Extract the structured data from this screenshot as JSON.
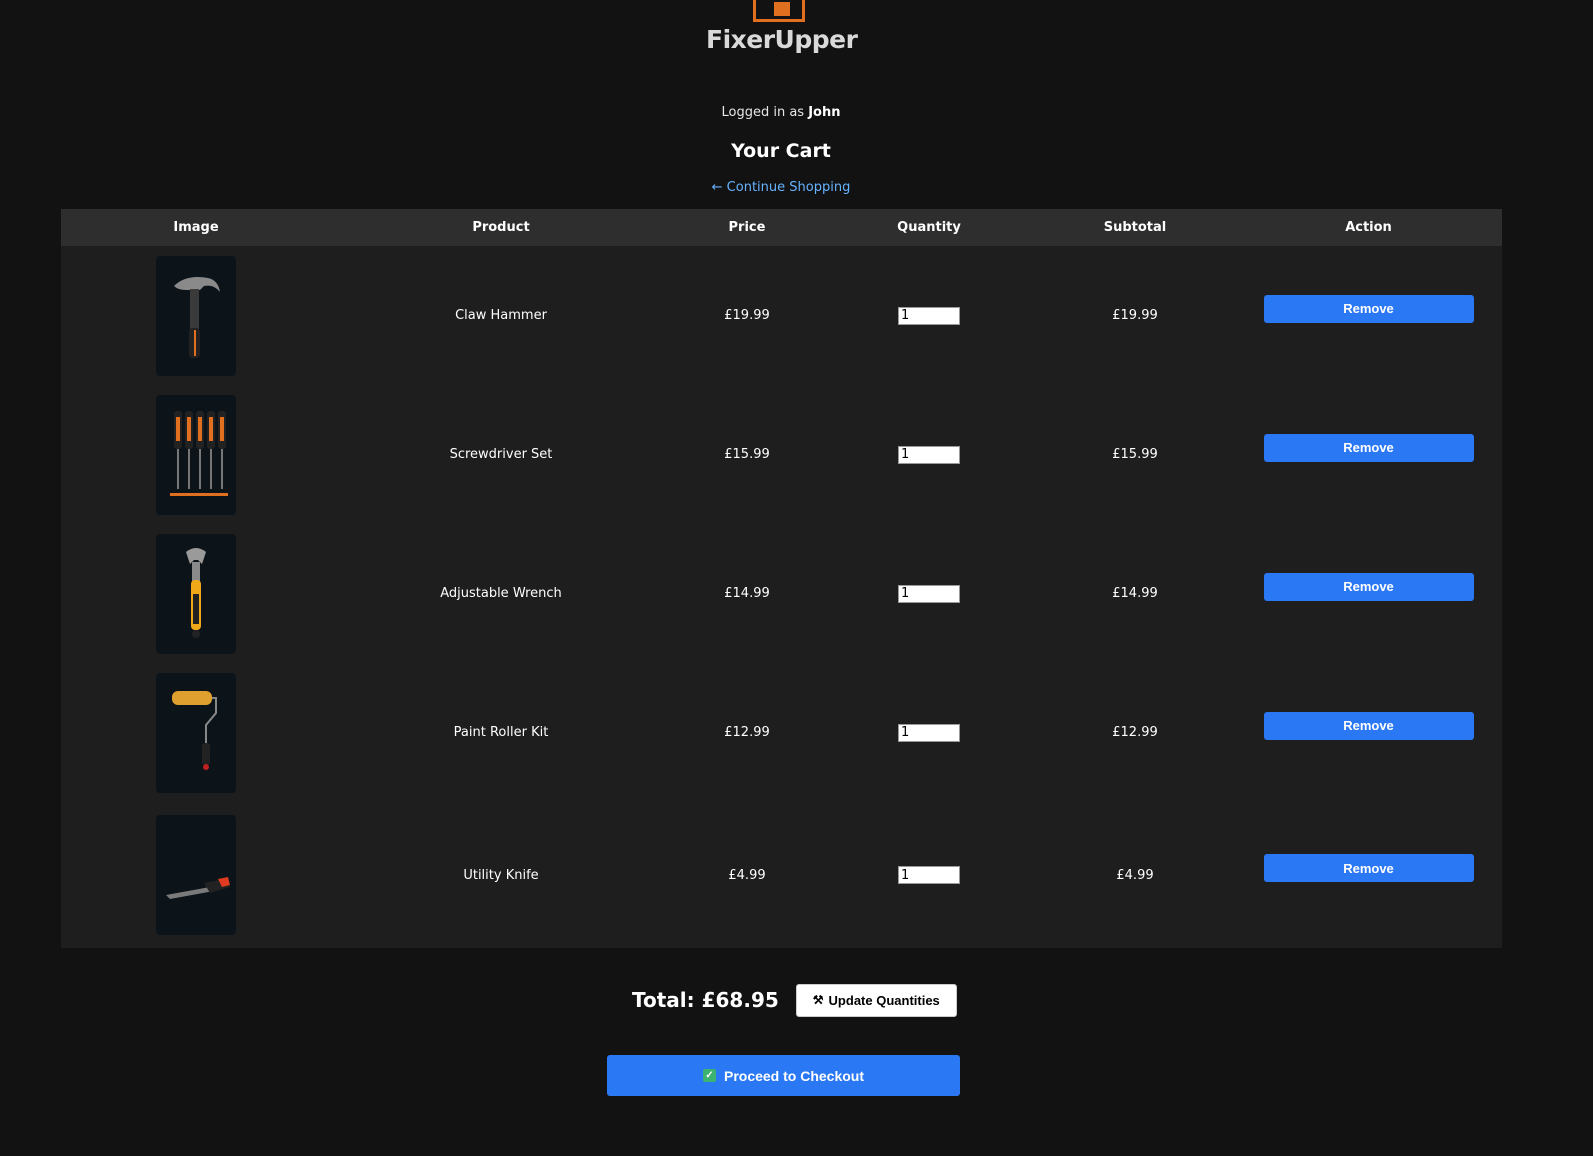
{
  "brand": {
    "name": "FixerUpper",
    "accent_color": "#e07020"
  },
  "session": {
    "prefix": "Logged in as",
    "username": "John"
  },
  "page": {
    "title": "Your Cart",
    "continue_link": "← Continue Shopping"
  },
  "cart": {
    "columns": [
      "Image",
      "Product",
      "Price",
      "Quantity",
      "Subtotal",
      "Action"
    ],
    "items": [
      {
        "product": "Claw Hammer",
        "price": "£19.99",
        "quantity": "1",
        "subtotal": "£19.99",
        "action": "Remove",
        "image_icon": "hammer-icon"
      },
      {
        "product": "Screwdriver Set",
        "price": "£15.99",
        "quantity": "1",
        "subtotal": "£15.99",
        "action": "Remove",
        "image_icon": "screwdriver-icon"
      },
      {
        "product": "Adjustable Wrench",
        "price": "£14.99",
        "quantity": "1",
        "subtotal": "£14.99",
        "action": "Remove",
        "image_icon": "wrench-icon"
      },
      {
        "product": "Paint Roller Kit",
        "price": "£12.99",
        "quantity": "1",
        "subtotal": "£12.99",
        "action": "Remove",
        "image_icon": "paint-roller-icon"
      },
      {
        "product": "Utility Knife",
        "price": "£4.99",
        "quantity": "1",
        "subtotal": "£4.99",
        "action": "Remove",
        "image_icon": "utility-knife-icon"
      }
    ]
  },
  "summary": {
    "total": "Total: £68.95",
    "update_label": "Update Quantities",
    "update_icon": "tools-icon",
    "checkout_label": "Proceed to Checkout",
    "checkout_icon": "checkmark-icon"
  },
  "colors": {
    "background": "#121212",
    "table_bg": "#1e1e1e",
    "header_bg": "#2e2e2e",
    "primary_button": "#2b78f5",
    "link": "#66b3ff"
  }
}
